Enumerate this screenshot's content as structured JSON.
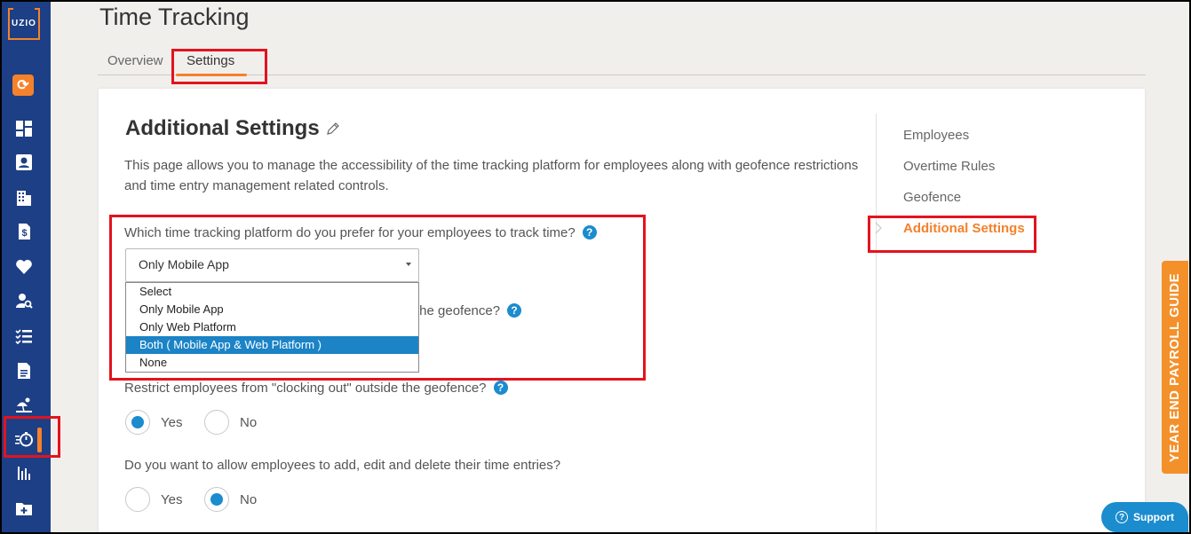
{
  "brand": {
    "logo_text": "UZIO",
    "accent": "#f5812b",
    "sidebar_bg": "#1d3f85"
  },
  "sidebar": {
    "icons": [
      "sync-icon",
      "dashboard-icon",
      "profile-icon",
      "company-icon",
      "payroll-icon",
      "benefits-icon",
      "user-search-icon",
      "checklist-icon",
      "document-icon",
      "holiday-icon",
      "time-tracking-icon",
      "reports-icon",
      "add-folder-icon"
    ]
  },
  "header": {
    "title": "Time Tracking"
  },
  "tabs": [
    {
      "label": "Overview"
    },
    {
      "label": "Settings"
    }
  ],
  "section": {
    "title": "Additional Settings",
    "description": "This page allows you to manage the accessibility of the time tracking platform for employees along with geofence restrictions and time entry management related controls."
  },
  "questions": {
    "platform": {
      "text": "Which time tracking platform do you prefer for your employees to track time?",
      "selected": "Only Mobile App",
      "options": [
        "Select",
        "Only Mobile App",
        "Only Web Platform",
        "Both ( Mobile App & Web Platform )",
        "None"
      ],
      "highlighted": "Both ( Mobile App & Web Platform )"
    },
    "clock_in_tail": "the geofence?",
    "clock_out": {
      "text": "Restrict employees from \"clocking out\" outside the geofence?",
      "yes": "Yes",
      "no": "No",
      "value": "Yes"
    },
    "edit_entries": {
      "text": "Do you want to allow employees to add, edit and delete their time entries?",
      "yes": "Yes",
      "no": "No",
      "value": "No"
    }
  },
  "side_nav": [
    {
      "label": "Employees"
    },
    {
      "label": "Overtime Rules"
    },
    {
      "label": "Geofence"
    },
    {
      "label": "Additional Settings",
      "active": true
    }
  ],
  "year_end_tab": "YEAR END PAYROLL GUIDE",
  "support": {
    "label": "Support"
  }
}
